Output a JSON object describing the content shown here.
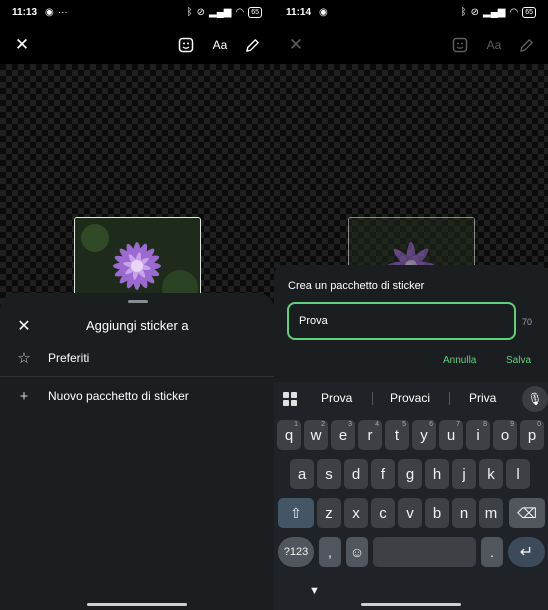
{
  "left": {
    "status": {
      "time": "11:13",
      "battery": "65"
    },
    "toolbar": {
      "text_label": "Aa"
    },
    "sheet": {
      "title": "Aggiungi sticker a",
      "items": [
        {
          "icon": "star-outline-icon",
          "label": "Preferiti"
        },
        {
          "icon": "plus-icon",
          "label": "Nuovo pacchetto di sticker"
        }
      ]
    }
  },
  "right": {
    "status": {
      "time": "11:14",
      "battery": "65"
    },
    "toolbar": {
      "text_label": "Aa"
    },
    "dialog": {
      "title": "Crea un pacchetto di sticker",
      "input_value": "Prova",
      "char_count": "70",
      "cancel_label": "Annulla",
      "save_label": "Salva"
    },
    "keyboard": {
      "suggestions": [
        "Prova",
        "Provaci",
        "Priva"
      ],
      "row1": [
        {
          "k": "q",
          "h": "1"
        },
        {
          "k": "w",
          "h": "2"
        },
        {
          "k": "e",
          "h": "3"
        },
        {
          "k": "r",
          "h": "4"
        },
        {
          "k": "t",
          "h": "5"
        },
        {
          "k": "y",
          "h": "6"
        },
        {
          "k": "u",
          "h": "7"
        },
        {
          "k": "i",
          "h": "8"
        },
        {
          "k": "o",
          "h": "9"
        },
        {
          "k": "p",
          "h": "0"
        }
      ],
      "row2": [
        "a",
        "s",
        "d",
        "f",
        "g",
        "h",
        "j",
        "k",
        "l"
      ],
      "row3": [
        "z",
        "x",
        "c",
        "v",
        "b",
        "n",
        "m"
      ],
      "sym_label": "?123",
      "comma": ",",
      "period": "."
    }
  },
  "colors": {
    "accent": "#5fd07c",
    "sheet_bg": "#1b1e21",
    "keyboard_bg": "#1f2226"
  }
}
